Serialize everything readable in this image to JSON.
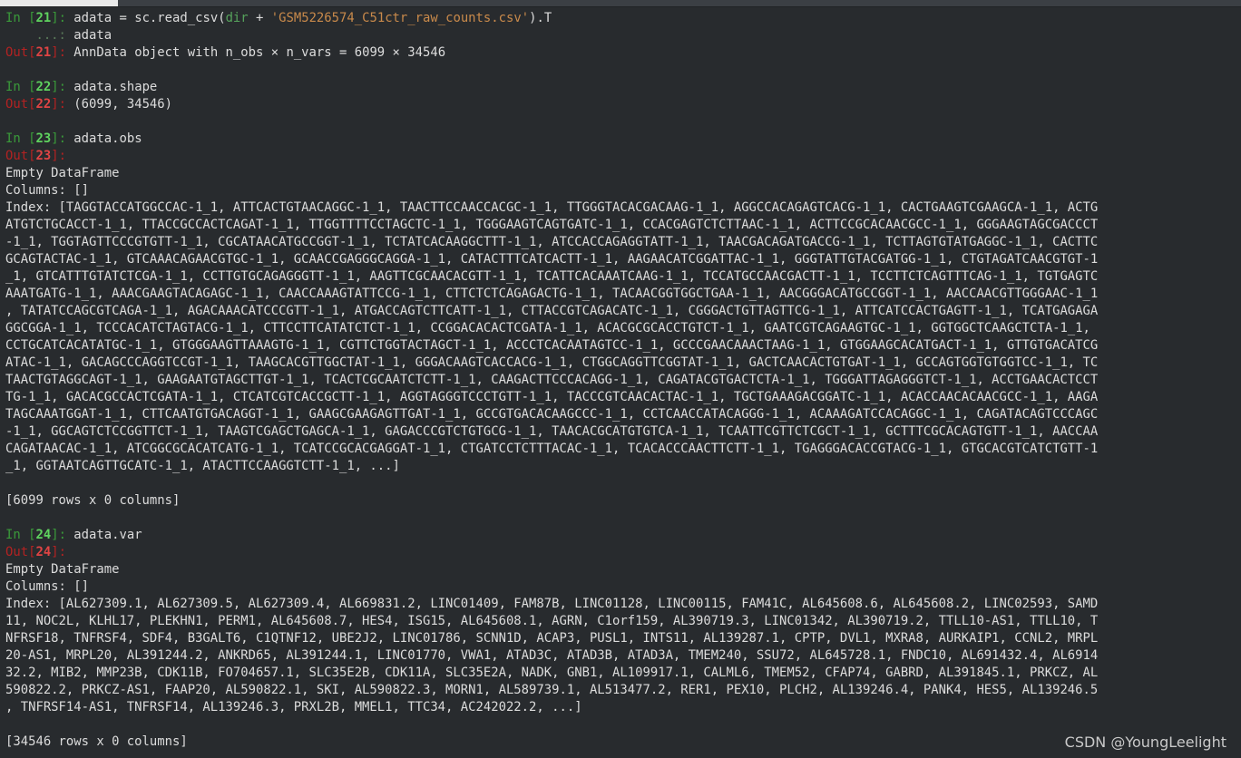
{
  "cells": [
    {
      "in_label": "In ",
      "num": "21",
      "code_line1_a": "adata = sc.read_csv(",
      "code_line1_dir": "dir",
      "code_line1_b": " + ",
      "code_line1_str": "'GSM5226574_C51ctr_raw_counts.csv'",
      "code_line1_c": ").T",
      "cont_prompt": "    ...: ",
      "code_line2": "adata",
      "out_label": "Out",
      "output": "AnnData object with n_obs × n_vars = 6099 × 34546"
    },
    {
      "in_label": "In ",
      "num": "22",
      "code": "adata.shape",
      "out_label": "Out",
      "output": "(6099, 34546)"
    },
    {
      "in_label": "In ",
      "num": "23",
      "code": "adata.obs",
      "out_label": "Out",
      "empty": "Empty DataFrame",
      "columns": "Columns: []",
      "index_lines": [
        "Index: [TAGGTACCATGGCCAC-1_1, ATTCACTGTAACAGGC-1_1, TAACTTCCAACCACGC-1_1, TTGGGTACACGACAAG-1_1, AGGCCACAGAGTCACG-1_1, CACTGAAGTCGAAGCA-1_1, ACTG",
        "ATGTCTGCACCT-1_1, TTACCGCCACTCAGAT-1_1, TTGGTTTTCCTAGCTC-1_1, TGGGAAGTCAGTGATC-1_1, CCACGAGTCTCTTAAC-1_1, ACTTCCGCACAACGCC-1_1, GGGAAGTAGCGACCCT",
        "-1_1, TGGTAGTTCCCGTGTT-1_1, CGCATAACATGCCGGT-1_1, TCTATCACAAGGCTTT-1_1, ATCCACCAGAGGTATT-1_1, TAACGACAGATGACCG-1_1, TCTTAGTGTATGAGGC-1_1, CACTTC",
        "GCAGTACTAC-1_1, GTCAAACAGAACGTGC-1_1, GCAACCGAGGGCAGGA-1_1, CATACTTTCATCACTT-1_1, AAGAACATCGGATTAC-1_1, GGGTATTGTACGATGG-1_1, CTGTAGATCAACGTGT-1",
        "_1, GTCATTTGTATCTCGA-1_1, CCTTGTGCAGAGGGTT-1_1, AAGTTCGCAACACGTT-1_1, TCATTCACAAATCAAG-1_1, TCCATGCCAACGACTT-1_1, TCCTTCTCAGTTTCAG-1_1, TGTGAGTC",
        "AAATGATG-1_1, AAACGAAGTACAGAGC-1_1, CAACCAAAGTATTCCG-1_1, CTTCTCTCAGAGACTG-1_1, TACAACGGTGGCTGAA-1_1, AACGGGACATGCCGGT-1_1, AACCAACGTTGGGAAC-1_1",
        ", TATATCCAGCGTCAGA-1_1, AGACAAACATCCCGTT-1_1, ATGACCAGTCTTCATT-1_1, CTTACCGTCAGACATC-1_1, CGGGACTGTTAGTTCG-1_1, ATTCATCCACTGAGTT-1_1, TCATGAGAGA",
        "GGCGGA-1_1, TCCCACATCTAGTACG-1_1, CTTCCTTCATATCTCT-1_1, CCGGACACACTCGATA-1_1, ACACGCGCACCTGTCT-1_1, GAATCGTCAGAAGTGC-1_1, GGTGGCTCAAGCTCTA-1_1,",
        "CCTGCATCACATATGC-1_1, GTGGGAAGTTAAAGTG-1_1, CGTTCTGGTACTAGCT-1_1, ACCCTCACAATAGTCC-1_1, GCCCGAACAAACTAAG-1_1, GTGGAAGCACATGACT-1_1, GTTGTGACATCG",
        "ATAC-1_1, GACAGCCCAGGTCCGT-1_1, TAAGCACGTTGGCTAT-1_1, GGGACAAGTCACCACG-1_1, CTGGCAGGTTCGGTAT-1_1, GACTCAACACTGTGAT-1_1, GCCAGTGGTGTGGTCC-1_1, TC",
        "TAACTGTAGGCAGT-1_1, GAAGAATGTAGCTTGT-1_1, TCACTCGCAATCTCTT-1_1, CAAGACTTCCCACAGG-1_1, CAGATACGTGACTCTA-1_1, TGGGATTAGAGGGTCT-1_1, ACCTGAACACTCCT",
        "TG-1_1, GACACGCCACTCGATA-1_1, CTCATCGTCACCGCTT-1_1, AGGTAGGGTCCCTGTT-1_1, TACCCGTCAACACTAC-1_1, TGCTGAAAGACGGATC-1_1, ACACCAACACAACGCC-1_1, AAGA",
        "TAGCAAATGGAT-1_1, CTTCAATGTGACAGGT-1_1, GAAGCGAAGAGTTGAT-1_1, GCCGTGACACAAGCCC-1_1, CCTCAACCATACAGGG-1_1, ACAAAGATCCACAGGC-1_1, CAGATACAGTCCCAGC",
        "-1_1, GGCAGTCTCCGGTTCT-1_1, TAAGTCGAGCTGAGCA-1_1, GAGACCCGTCTGTGCG-1_1, TAACACGCATGTGTCA-1_1, TCAATTCGTTCTCGCT-1_1, GCTTTCGCACAGTGTT-1_1, AACCAA",
        "CAGATAACAC-1_1, ATCGGCGCACATCATG-1_1, TCATCCGCACGAGGAT-1_1, CTGATCCTCTTTACAC-1_1, TCACACCCAACTTCTT-1_1, TGAGGGACACCGTACG-1_1, GTGCACGTCATCTGTT-1",
        "_1, GGTAATCAGTTGCATC-1_1, ATACTTCCAAGGTCTT-1_1, ...]"
      ],
      "shape": "[6099 rows x 0 columns]"
    },
    {
      "in_label": "In ",
      "num": "24",
      "code": "adata.var",
      "out_label": "Out",
      "empty": "Empty DataFrame",
      "columns": "Columns: []",
      "index_lines": [
        "Index: [AL627309.1, AL627309.5, AL627309.4, AL669831.2, LINC01409, FAM87B, LINC01128, LINC00115, FAM41C, AL645608.6, AL645608.2, LINC02593, SAMD",
        "11, NOC2L, KLHL17, PLEKHN1, PERM1, AL645608.7, HES4, ISG15, AL645608.1, AGRN, C1orf159, AL390719.3, LINC01342, AL390719.2, TTLL10-AS1, TTLL10, T",
        "NFRSF18, TNFRSF4, SDF4, B3GALT6, C1QTNF12, UBE2J2, LINC01786, SCNN1D, ACAP3, PUSL1, INTS11, AL139287.1, CPTP, DVL1, MXRA8, AURKAIP1, CCNL2, MRPL",
        "20-AS1, MRPL20, AL391244.2, ANKRD65, AL391244.1, LINC01770, VWA1, ATAD3C, ATAD3B, ATAD3A, TMEM240, SSU72, AL645728.1, FNDC10, AL691432.4, AL6914",
        "32.2, MIB2, MMP23B, CDK11B, FO704657.1, SLC35E2B, CDK11A, SLC35E2A, NADK, GNB1, AL109917.1, CALML6, TMEM52, CFAP74, GABRD, AL391845.1, PRKCZ, AL",
        "590822.2, PRKCZ-AS1, FAAP20, AL590822.1, SKI, AL590822.3, MORN1, AL589739.1, AL513477.2, RER1, PEX10, PLCH2, AL139246.4, PANK4, HES5, AL139246.5",
        ", TNFRSF14-AS1, TNFRSF14, AL139246.3, PRXL2B, MMEL1, TTC34, AC242022.2, ...]"
      ],
      "shape": "[34546 rows x 0 columns]"
    }
  ],
  "watermark": "CSDN @YoungLeelight",
  "colors": {
    "background": "#282b2e",
    "prompt_in": "#5fd35f",
    "prompt_out": "#e04444",
    "string": "#c98a4b"
  }
}
